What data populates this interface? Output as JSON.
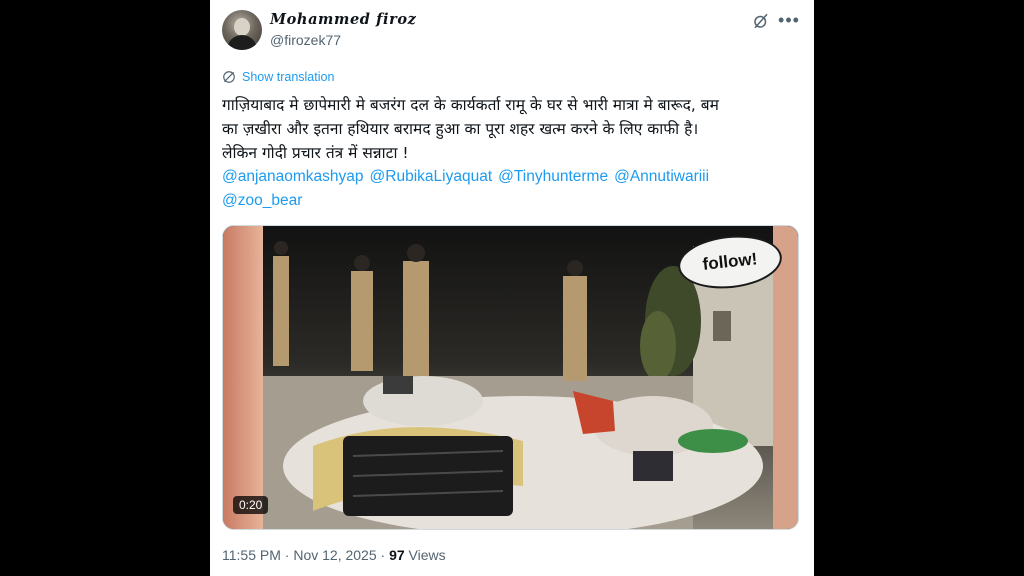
{
  "author": {
    "name": "Mohammed firoz",
    "handle": "@firozek77"
  },
  "icons": {
    "grok": "grok-icon",
    "more": "more-icon",
    "translate": "globe-icon"
  },
  "show_translation": "Show translation",
  "tweet": {
    "text": "गाज़ियाबाद मे छापेमारी मे बजरंग दल के कार्यकर्ता रामू के घर से भारी मात्रा मे बारूद, बम\nका ज़खीरा और इतना हथियार बरामद हुआ का पूरा शहर खत्म करने के लिए काफी है।\nलेकिन गोदी प्रचार तंत्र में सन्नाटा !",
    "mentions": [
      "@anjanaomkashyap",
      "@RubikaLiyaquat",
      "@Tinyhunterme",
      "@Annutiwariii",
      "@zoo_bear"
    ]
  },
  "video": {
    "duration": "0:20",
    "overlay_label": "follow!"
  },
  "meta": {
    "time": "11:55 PM",
    "separator": " · ",
    "date": "Nov 12, 2025",
    "views_count": "97",
    "views_label": " Views"
  },
  "colors": {
    "link": "#1d9bf0",
    "text": "#0f1419",
    "secondary": "#536471"
  }
}
